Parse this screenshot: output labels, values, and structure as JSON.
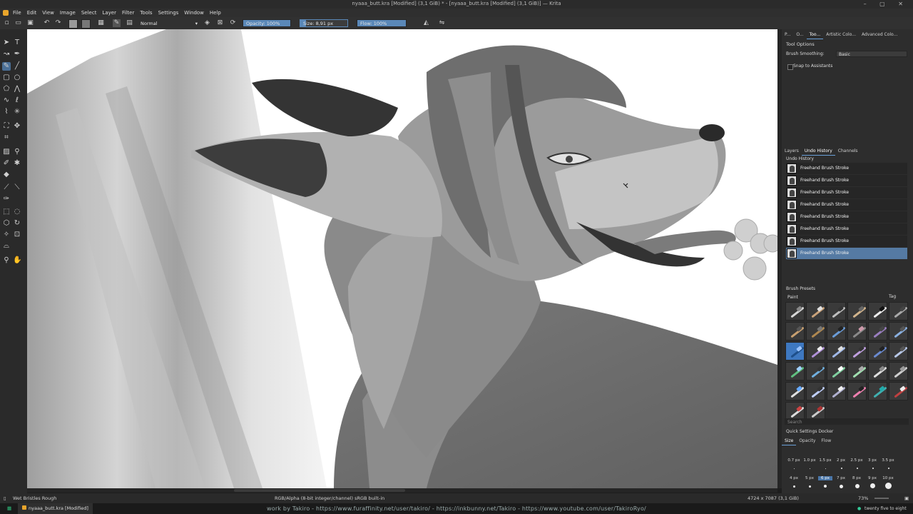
{
  "window": {
    "title": "nyaaa_butt.kra [Modified] (3,1 GiB) * - [nyaaa_butt.kra [Modified] (3,1 GiB)] — Krita",
    "controls": "– ▢ ✕"
  },
  "menu": [
    "File",
    "Edit",
    "View",
    "Image",
    "Select",
    "Layer",
    "Filter",
    "Tools",
    "Settings",
    "Window",
    "Help"
  ],
  "toolbar": {
    "blend_mode": "Normal",
    "opacity": "Opacity: 100%",
    "opacity_value": 1.0,
    "size": "Size: 8,91 px",
    "flow": "Flow: 100%",
    "flow_value": 1.0
  },
  "dock": {
    "top_tabs": [
      "P...",
      "O...",
      "Too...",
      "Artistic Colo...",
      "Advanced Colo..."
    ],
    "tool_options": {
      "title": "Tool Options",
      "smoothing_label": "Brush Smoothing:",
      "smoothing_value": "Basic",
      "snap_label": "Snap to Assistants"
    },
    "mid_tabs": [
      "Layers",
      "Undo History",
      "Channels"
    ],
    "undo": {
      "title": "Undo History",
      "items": [
        "Freehand Brush Stroke",
        "Freehand Brush Stroke",
        "Freehand Brush Stroke",
        "Freehand Brush Stroke",
        "Freehand Brush Stroke",
        "Freehand Brush Stroke",
        "Freehand Brush Stroke",
        "Freehand Brush Stroke"
      ]
    },
    "brush_presets": {
      "title": "Brush Presets",
      "filter": "Paint",
      "tag_label": "Tag",
      "search_placeholder": "Search"
    },
    "quick_settings": {
      "title": "Quick Settings Docker",
      "tabs": [
        "Size",
        "Opacity",
        "Flow"
      ],
      "sizes_row1": [
        "0.7 px",
        "1.0 px",
        "1.5 px",
        "2 px",
        "2.5 px",
        "3 px",
        "3.5 px"
      ],
      "sizes_row2": [
        "4 px",
        "5 px",
        "6 px",
        "7 px",
        "8 px",
        "9 px",
        "10 px"
      ]
    }
  },
  "status": {
    "brush": "Wet Bristles Rough",
    "color_space": "RGB/Alpha (8-bit integer/channel)  sRGB built-in",
    "dimensions": "4724 x 7087 (3,1 GiB)",
    "zoom": "73%"
  },
  "taskbar": {
    "app": "nyaaa_butt.kra [Modified]",
    "credit": "work by Takiro - https://www.furaffinity.net/user/takiro/ - https://inkbunny.net/Takiro - https://www.youtube.com/user/TakiroRyo/",
    "clock": "twenty five to eight"
  },
  "colors": {
    "accent": "#557aa3",
    "panel": "#2d2d2d",
    "canvas": "#ffffff"
  }
}
